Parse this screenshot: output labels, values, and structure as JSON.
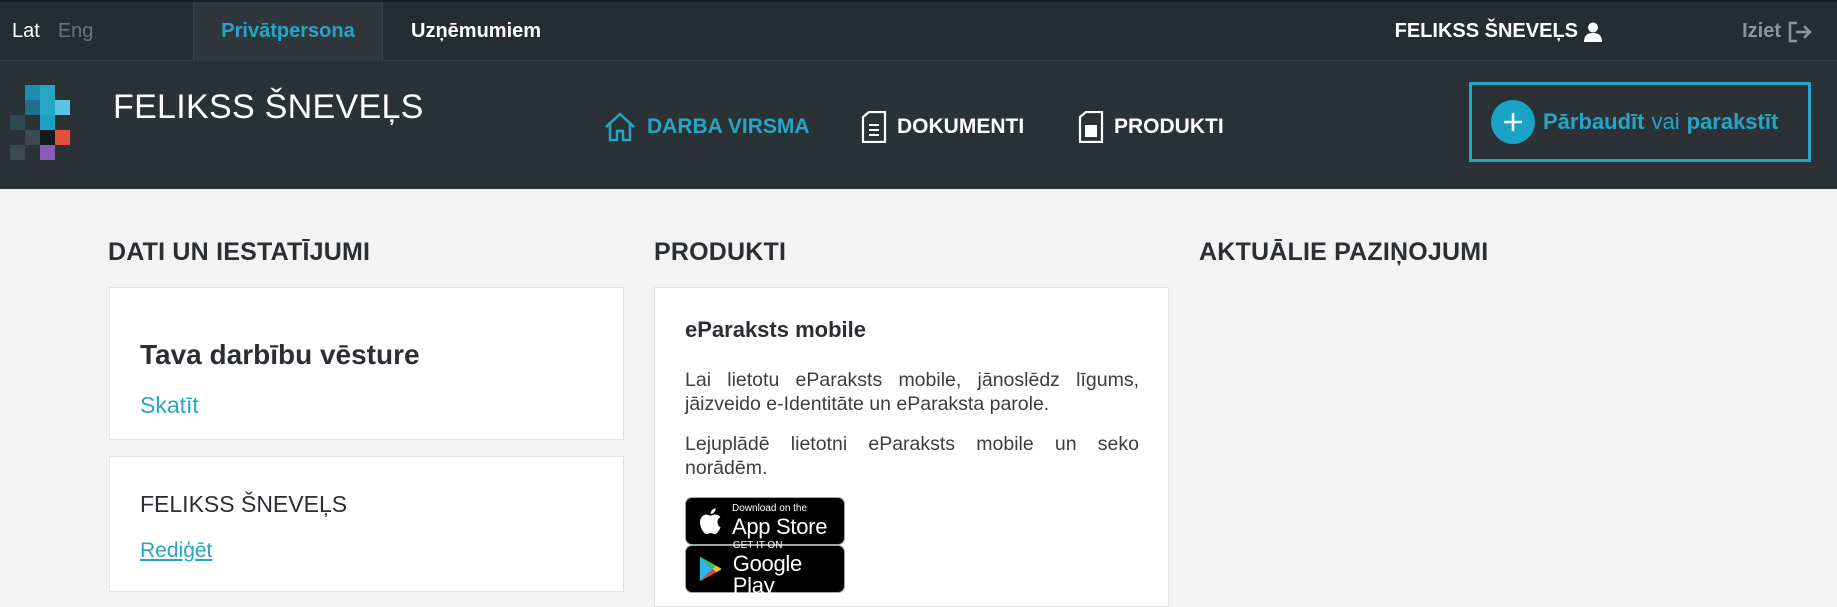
{
  "topbar": {
    "lang_lat": "Lat",
    "lang_eng": "Eng",
    "tab_private": "Privātpersona",
    "tab_company": "Uzņēmumiem",
    "user_name": "FELIKSS ŠNEVEĻS",
    "logout": "Iziet"
  },
  "header": {
    "brand": "FELIKSS ŠNEVEĻS",
    "nav": {
      "dashboard": "DARBA VIRSMA",
      "documents": "DOKUMENTI",
      "products": "PRODUKTI"
    },
    "cta": {
      "check": "Pārbaudīt",
      "or": "vai",
      "sign": "parakstīt"
    }
  },
  "sections": {
    "settings_title": "DATI UN IESTATĪJUMI",
    "products_title": "PRODUKTI",
    "news_title": "AKTUĀLIE PAZIŅOJUMI"
  },
  "history_card": {
    "title": "Tava darbību vēsture",
    "link": "Skatīt"
  },
  "profile_card": {
    "name": "FELIKSS ŠNEVEĻS",
    "edit": "Rediģēt"
  },
  "mobile_card": {
    "title": "eParaksts mobile",
    "para1": "Lai lietotu eParaksts mobile, jānoslēdz līgums, jāizveido e-Identitāte un eParaksta parole.",
    "para2": "Lejuplādē lietotni eParaksts mobile un seko norādēm.",
    "appstore_small": "Download on the",
    "appstore_big": "App Store",
    "googleplay_small": "GET IT ON",
    "googleplay_big": "Google Play"
  },
  "colors": {
    "accent": "#27a5c6",
    "topbar_bg": "#262d31",
    "header_bg": "#2a3236",
    "page_bg": "#f3f3f3"
  }
}
